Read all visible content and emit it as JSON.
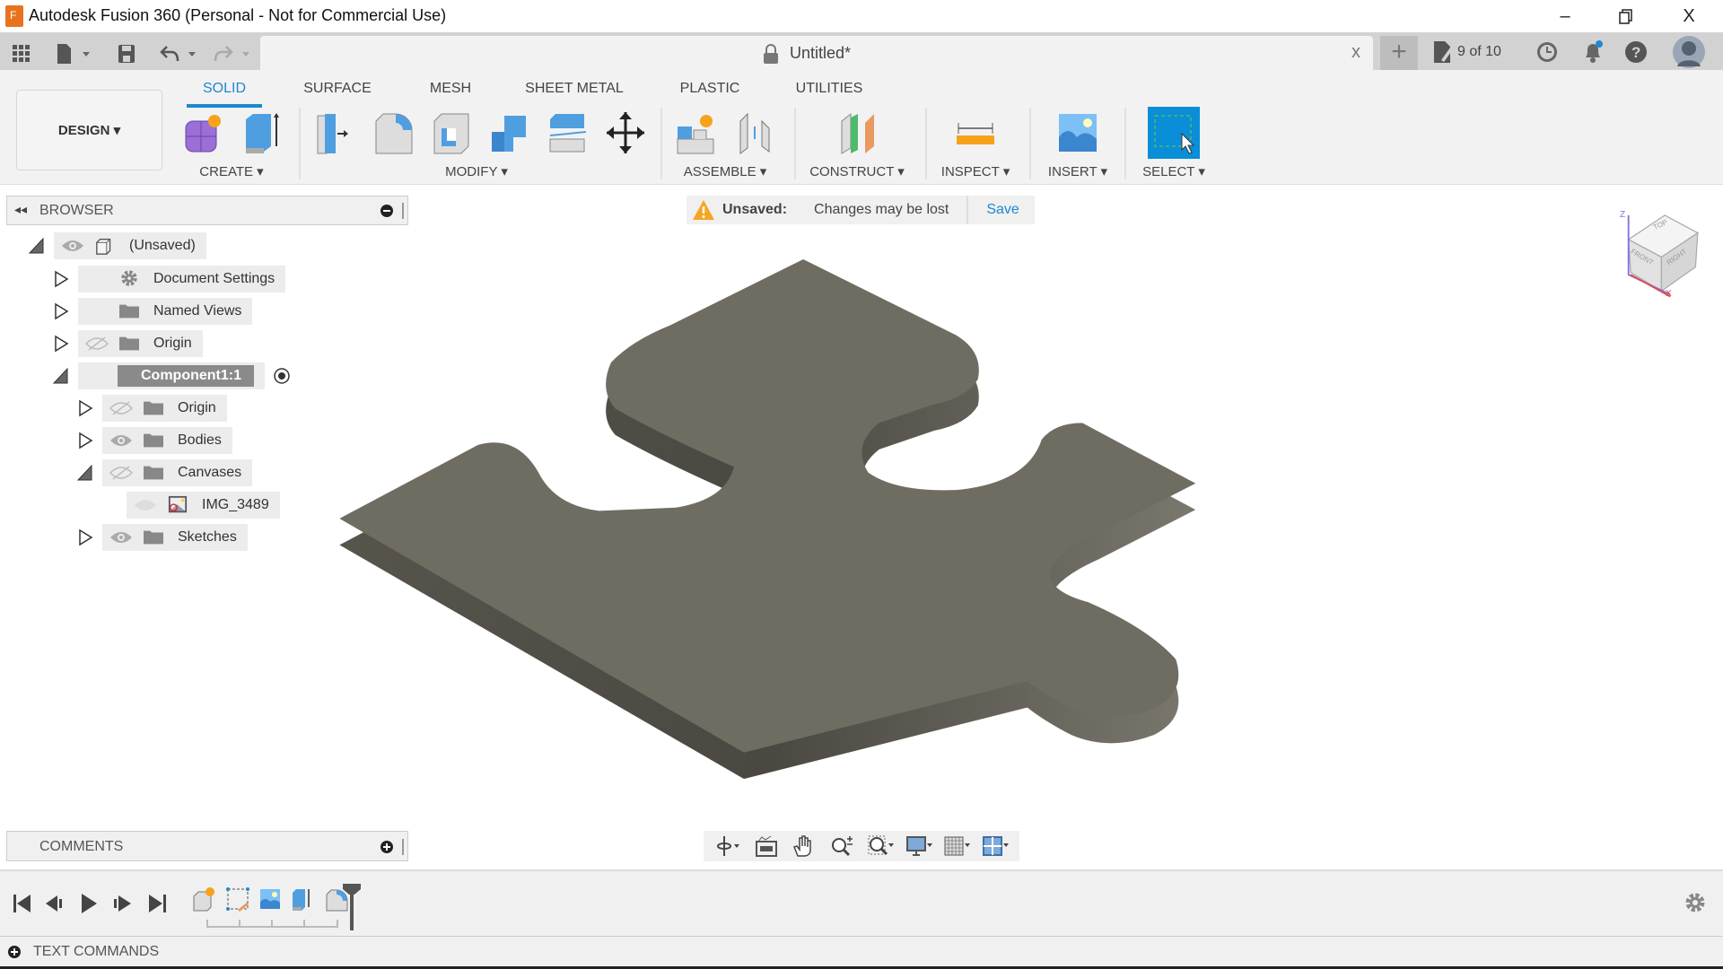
{
  "window": {
    "title": "Autodesk Fusion 360 (Personal - Not for Commercial Use)",
    "minimize": "–",
    "close": "X"
  },
  "document": {
    "tab_title": "Untitled*",
    "close": "x",
    "new_tab": "+",
    "version_count": "9 of 10"
  },
  "workspace": {
    "label": "DESIGN ▾"
  },
  "ribbon": {
    "tabs": [
      {
        "label": "SOLID",
        "active": true
      },
      {
        "label": "SURFACE"
      },
      {
        "label": "MESH"
      },
      {
        "label": "SHEET METAL"
      },
      {
        "label": "PLASTIC"
      },
      {
        "label": "UTILITIES"
      }
    ],
    "groups": [
      {
        "label": "CREATE ▾"
      },
      {
        "label": "MODIFY ▾"
      },
      {
        "label": "ASSEMBLE ▾"
      },
      {
        "label": "CONSTRUCT ▾"
      },
      {
        "label": "INSPECT ▾"
      },
      {
        "label": "INSERT ▾"
      },
      {
        "label": "SELECT ▾"
      }
    ]
  },
  "browser": {
    "title": "BROWSER",
    "items": [
      {
        "label": "(Unsaved)",
        "icon": "component-icon",
        "expanded": true,
        "visible": true
      },
      {
        "label": "Document Settings",
        "icon": "gear-icon"
      },
      {
        "label": "Named Views",
        "icon": "folder-icon"
      },
      {
        "label": "Origin",
        "icon": "folder-icon",
        "visible": false
      },
      {
        "label": "Component1:1",
        "icon": "component-icon",
        "expanded": true,
        "selected": true
      },
      {
        "label": "Origin",
        "icon": "folder-icon",
        "visible": false
      },
      {
        "label": "Bodies",
        "icon": "folder-icon",
        "visible": true
      },
      {
        "label": "Canvases",
        "icon": "folder-icon",
        "expanded": true,
        "visible": false
      },
      {
        "label": "IMG_3489",
        "icon": "image-icon"
      },
      {
        "label": "Sketches",
        "icon": "folder-icon",
        "visible": true
      }
    ]
  },
  "banner": {
    "status": "Unsaved:",
    "message": "Changes may be lost",
    "action": "Save"
  },
  "viewcube": {
    "top": "TOP",
    "front": "FRONT",
    "right": "RIGHT",
    "axis_x": "X",
    "axis_z": "Z"
  },
  "comments": {
    "title": "COMMENTS"
  },
  "text_commands": {
    "title": "TEXT COMMANDS"
  },
  "colors": {
    "accent": "#1e88d0",
    "warning": "#f5a623",
    "body_top": "#6f6c62",
    "body_side": "#4b4942"
  }
}
